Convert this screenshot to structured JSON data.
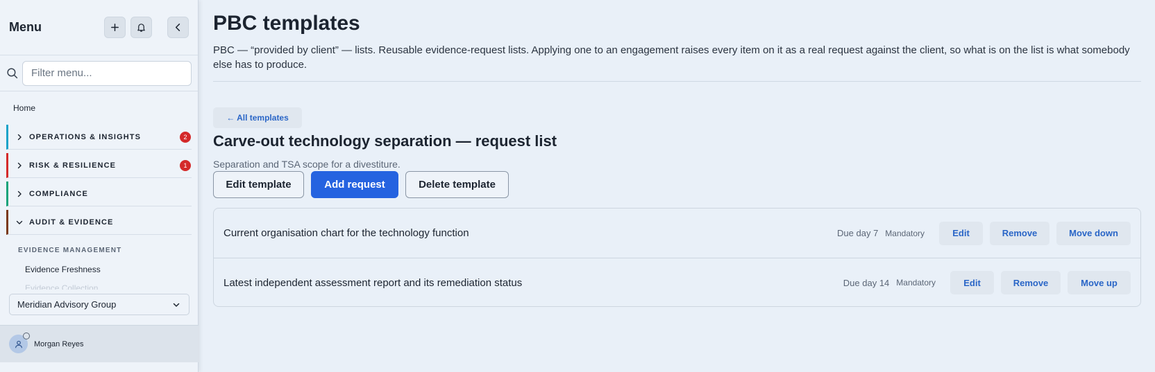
{
  "sidebar": {
    "title": "Menu",
    "search_placeholder": "Filter menu...",
    "home_label": "Home",
    "groups": [
      {
        "label": "OPERATIONS & INSIGHTS",
        "badge": "2",
        "accent": "#1aa3c9",
        "expanded": false
      },
      {
        "label": "RISK & RESILIENCE",
        "badge": "1",
        "accent": "#d42a2a",
        "expanded": false
      },
      {
        "label": "COMPLIANCE",
        "badge": "",
        "accent": "#16a37a",
        "expanded": false
      },
      {
        "label": "AUDIT & EVIDENCE",
        "badge": "",
        "accent": "#7a3a1a",
        "expanded": true
      }
    ],
    "sub_heading": "EVIDENCE MANAGEMENT",
    "sub_items": [
      "Evidence Freshness",
      "Evidence Collection"
    ],
    "org_select": "Meridian Advisory Group",
    "user_name": "Morgan Reyes"
  },
  "main": {
    "title": "PBC templates",
    "description": "PBC — “provided by client” — lists. Reusable evidence-request lists. Applying one to an engagement raises every item on it as a real request against the client, so what is on the list is what somebody else has to produce.",
    "back_link": "← All templates",
    "template_title": "Carve-out technology separation — request list",
    "template_desc": "Separation and TSA scope for a divestiture.",
    "buttons": {
      "edit": "Edit template",
      "add": "Add request",
      "delete": "Delete template"
    },
    "requests": [
      {
        "text": "Current organisation chart for the technology function",
        "due": "Due day 7",
        "flag": "Mandatory",
        "edit": "Edit",
        "remove": "Remove",
        "move": "Move down"
      },
      {
        "text": "Latest independent assessment report and its remediation status",
        "due": "Due day 14",
        "flag": "Mandatory",
        "edit": "Edit",
        "remove": "Remove",
        "move": "Move up"
      }
    ]
  },
  "colors": {
    "primary": "#2563e0",
    "link": "#2a66c7",
    "badge": "#d42a2a"
  }
}
